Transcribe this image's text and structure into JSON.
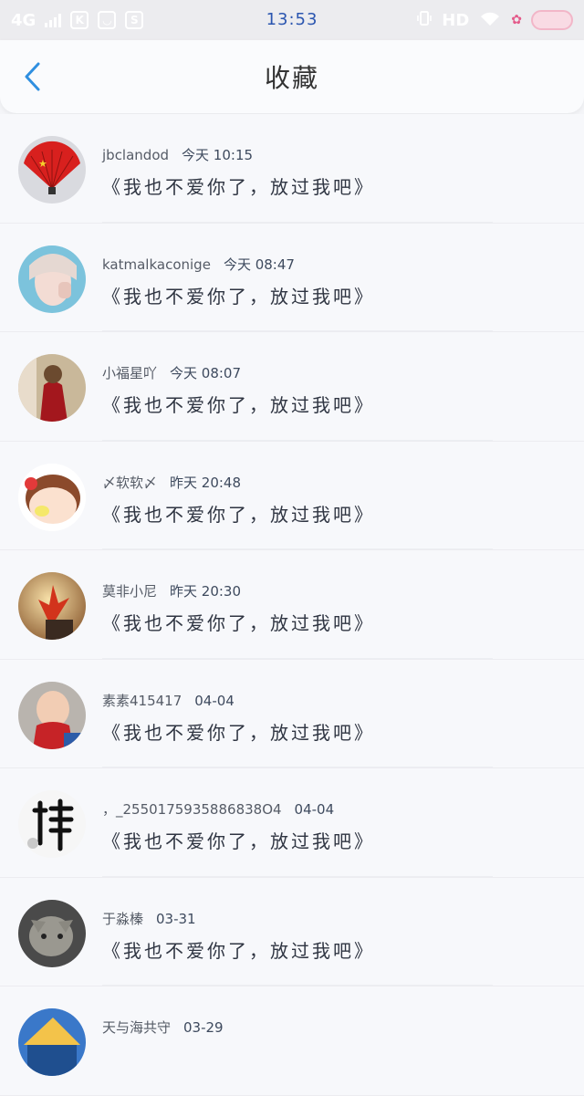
{
  "status_bar": {
    "network": "4G",
    "time": "13:53",
    "hd": "HD",
    "icons": [
      "signal-icon",
      "kuaishou-icon",
      "douyin-icon",
      "s-app-icon",
      "vibrate-icon",
      "wifi-icon",
      "flower-icon",
      "bow-icon"
    ]
  },
  "nav": {
    "title": "收藏",
    "back_icon": "chevron-left-icon"
  },
  "items": [
    {
      "name": "jbclandod",
      "time": "今天 10:15",
      "message": "《我也不爱你了，放过我吧》"
    },
    {
      "name": "katmalkaconige",
      "time": "今天 08:47",
      "message": "《我也不爱你了，放过我吧》"
    },
    {
      "name": "小福星吖",
      "time": "今天 08:07",
      "message": "《我也不爱你了，放过我吧》"
    },
    {
      "name": "〆软软〆",
      "time": "昨天 20:48",
      "message": "《我也不爱你了，放过我吧》"
    },
    {
      "name": "莫非小尼",
      "time": "昨天 20:30",
      "message": "《我也不爱你了，放过我吧》"
    },
    {
      "name": "素素415417",
      "time": "04-04",
      "message": "《我也不爱你了，放过我吧》"
    },
    {
      "name": "，_2550175935886838O4",
      "time": "04-04",
      "message": "《我也不爱你了，放过我吧》"
    },
    {
      "name": "于淼榛",
      "time": "03-31",
      "message": "《我也不爱你了，放过我吧》"
    },
    {
      "name": "天与海共守",
      "time": "03-29",
      "message": ""
    }
  ],
  "colors": {
    "accent": "#2f8fe0",
    "status_time": "#2b56b0",
    "background": "#f4f5f8"
  }
}
